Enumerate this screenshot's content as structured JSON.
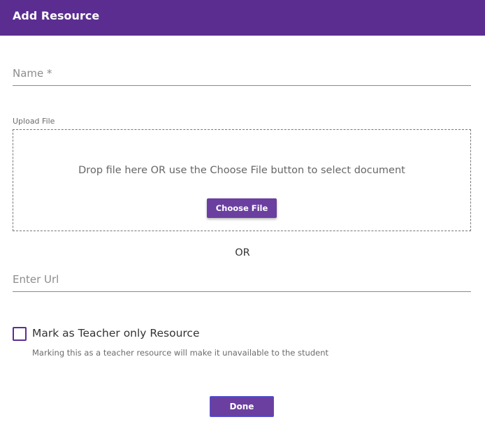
{
  "dialog": {
    "title": "Add Resource",
    "header_color": "#5c2d91"
  },
  "name_field": {
    "placeholder": "Name *",
    "value": ""
  },
  "upload": {
    "label": "Upload File",
    "dropzone_text": "Drop file here OR use the Choose File button to select document",
    "choose_button_label": "Choose File"
  },
  "separator": {
    "or_text": "OR"
  },
  "url_field": {
    "placeholder": "Enter Url",
    "value": ""
  },
  "teacher_only": {
    "label": "Mark as Teacher only Resource",
    "checked": false,
    "hint": "Marking this as a teacher resource will make it unavailable to the student"
  },
  "actions": {
    "done_label": "Done",
    "button_color": "#6b3fa0"
  }
}
